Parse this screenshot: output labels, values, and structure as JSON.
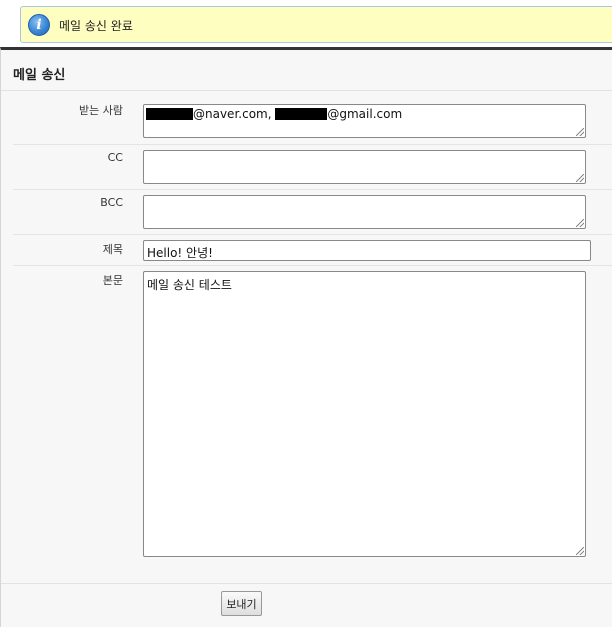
{
  "notice": {
    "icon": "info-icon",
    "icon_glyph": "i",
    "text": "메일 송신 완료"
  },
  "panel": {
    "title": "메일 송신"
  },
  "form": {
    "to": {
      "label": "받는 사람",
      "address1_domain": "@naver.com,",
      "address2_domain": "@gmail.com"
    },
    "cc": {
      "label": "CC",
      "value": ""
    },
    "bcc": {
      "label": "BCC",
      "value": ""
    },
    "subject": {
      "label": "제목",
      "value": "Hello! 안녕!"
    },
    "body": {
      "label": "본문",
      "value": "메일 송신 테스트"
    }
  },
  "actions": {
    "send_label": "보내기"
  },
  "colors": {
    "notice_bg": "#fefec0",
    "notice_border": "#a9c7e2",
    "panel_bg": "#f7f7f7",
    "panel_top_border": "#333333"
  }
}
